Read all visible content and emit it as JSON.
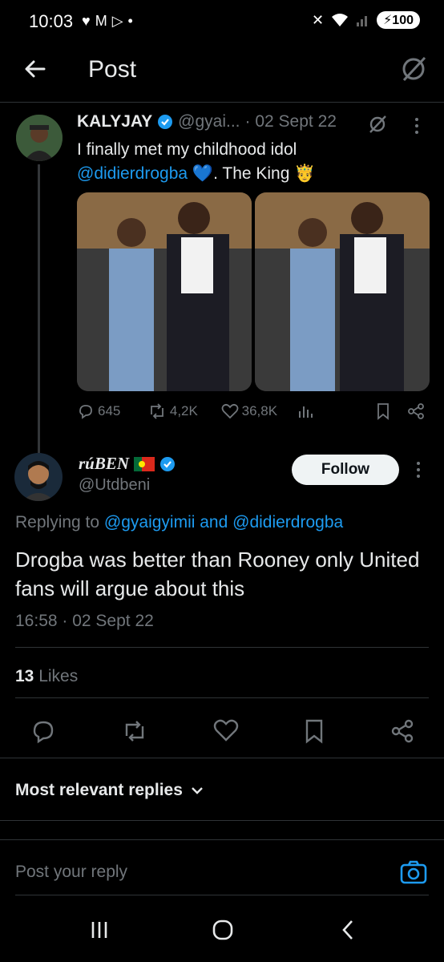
{
  "status_bar": {
    "time": "10:03",
    "battery": "100"
  },
  "header": {
    "title": "Post"
  },
  "parent_post": {
    "display_name": "KALYJAY",
    "handle": "@gyai...",
    "date": "· 02 Sept 22",
    "text_line1": "I finally met my childhood idol",
    "mention": "@didierdrogba",
    "text_rest": ". The King ",
    "stats": {
      "replies": "645",
      "reposts": "4,2K",
      "likes": "36,8K"
    }
  },
  "reply_post": {
    "display_name": "rúBEN",
    "handle": "@Utdbeni",
    "follow_label": "Follow",
    "replying_prefix": "Replying to ",
    "replying_users": "@gyaigyimii and @didierdrogba",
    "text": "Drogba was better than Rooney only United fans will argue about this",
    "timestamp": "16:58 · 02 Sept 22",
    "likes_count": "13",
    "likes_label": " Likes"
  },
  "replies_filter": {
    "label": "Most relevant replies"
  },
  "composer": {
    "placeholder": "Post your reply"
  },
  "colors": {
    "accent": "#1d9bf0",
    "muted": "#71767b",
    "text": "#e7e9ea",
    "background": "#000000",
    "divider": "#2f3336"
  }
}
